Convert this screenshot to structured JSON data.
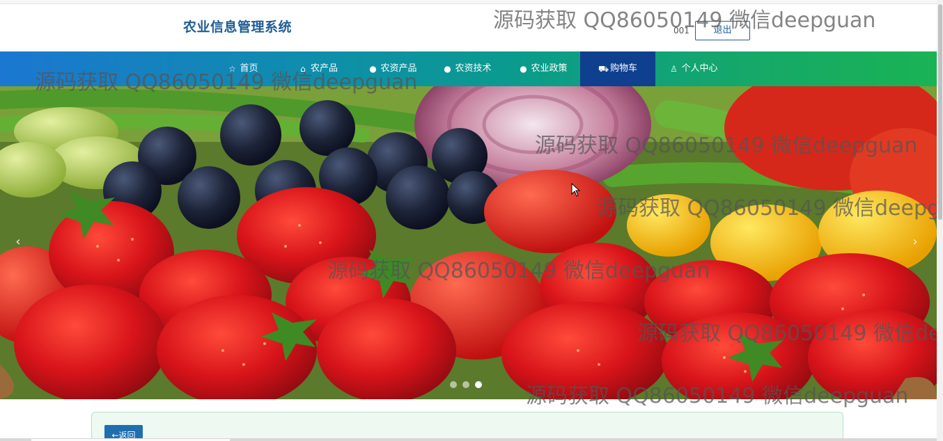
{
  "header": {
    "site_title": "农业信息管理系统",
    "username": "001",
    "logout_label": "退出"
  },
  "nav": {
    "items": [
      {
        "label": "首页",
        "icon": "star-icon"
      },
      {
        "label": "农产品",
        "icon": "bag-icon"
      },
      {
        "label": "农资产品",
        "icon": "info-icon"
      },
      {
        "label": "农资技术",
        "icon": "question-icon"
      },
      {
        "label": "农业政策",
        "icon": "info-icon"
      },
      {
        "label": "购物车",
        "icon": "cart-icon",
        "active": true
      },
      {
        "label": "个人中心",
        "icon": "user-icon"
      }
    ]
  },
  "carousel": {
    "prev": "‹",
    "next": "›",
    "slide_count": 3,
    "active_slide": 3
  },
  "content": {
    "back_label": "←返回"
  },
  "watermark": "源码获取 QQ86050149 微信deepguan",
  "colors": {
    "brand": "#1f5d96",
    "nav_active": "#0f3f8f",
    "nav_gradient_start": "#1b77d1",
    "nav_gradient_end": "#1ab354",
    "back_button": "#1f6eb0"
  }
}
